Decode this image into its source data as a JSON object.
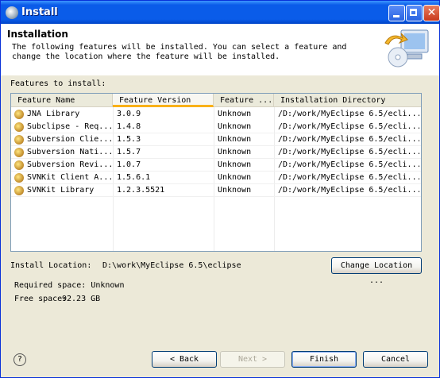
{
  "window": {
    "title": "Install"
  },
  "header": {
    "title": "Installation",
    "description": "The following features will be installed. You can select a feature and change the location where the feature will be installed."
  },
  "features_label": "Features to install:",
  "table": {
    "columns": [
      "Feature Name",
      "Feature Version",
      "Feature ...",
      "Installation Directory"
    ],
    "rows": [
      {
        "name": "JNA Library",
        "version": "3.0.9",
        "size": "Unknown",
        "dir": "/D:/work/MyEclipse 6.5/ecli..."
      },
      {
        "name": "Subclipse - Req...",
        "version": "1.4.8",
        "size": "Unknown",
        "dir": "/D:/work/MyEclipse 6.5/ecli..."
      },
      {
        "name": "Subversion Clie...",
        "version": "1.5.3",
        "size": "Unknown",
        "dir": "/D:/work/MyEclipse 6.5/ecli..."
      },
      {
        "name": "Subversion Nati...",
        "version": "1.5.7",
        "size": "Unknown",
        "dir": "/D:/work/MyEclipse 6.5/ecli..."
      },
      {
        "name": "Subversion Revi...",
        "version": "1.0.7",
        "size": "Unknown",
        "dir": "/D:/work/MyEclipse 6.5/ecli..."
      },
      {
        "name": "SVNKit Client A...",
        "version": "1.5.6.1",
        "size": "Unknown",
        "dir": "/D:/work/MyEclipse 6.5/ecli..."
      },
      {
        "name": "SVNKit Library",
        "version": "1.2.3.5521",
        "size": "Unknown",
        "dir": "/D:/work/MyEclipse 6.5/ecli..."
      }
    ]
  },
  "install_location": {
    "label": "Install Location:",
    "value": "D:\\work\\MyEclipse 6.5\\eclipse"
  },
  "change_location_button": "Change Location ...",
  "required_space": "Required space: Unknown",
  "free_space": {
    "label": "Free space:",
    "value": "92.23 GB"
  },
  "buttons": {
    "back": "< Back",
    "next": "Next >",
    "finish": "Finish",
    "cancel": "Cancel"
  },
  "help_icon": "help-icon"
}
